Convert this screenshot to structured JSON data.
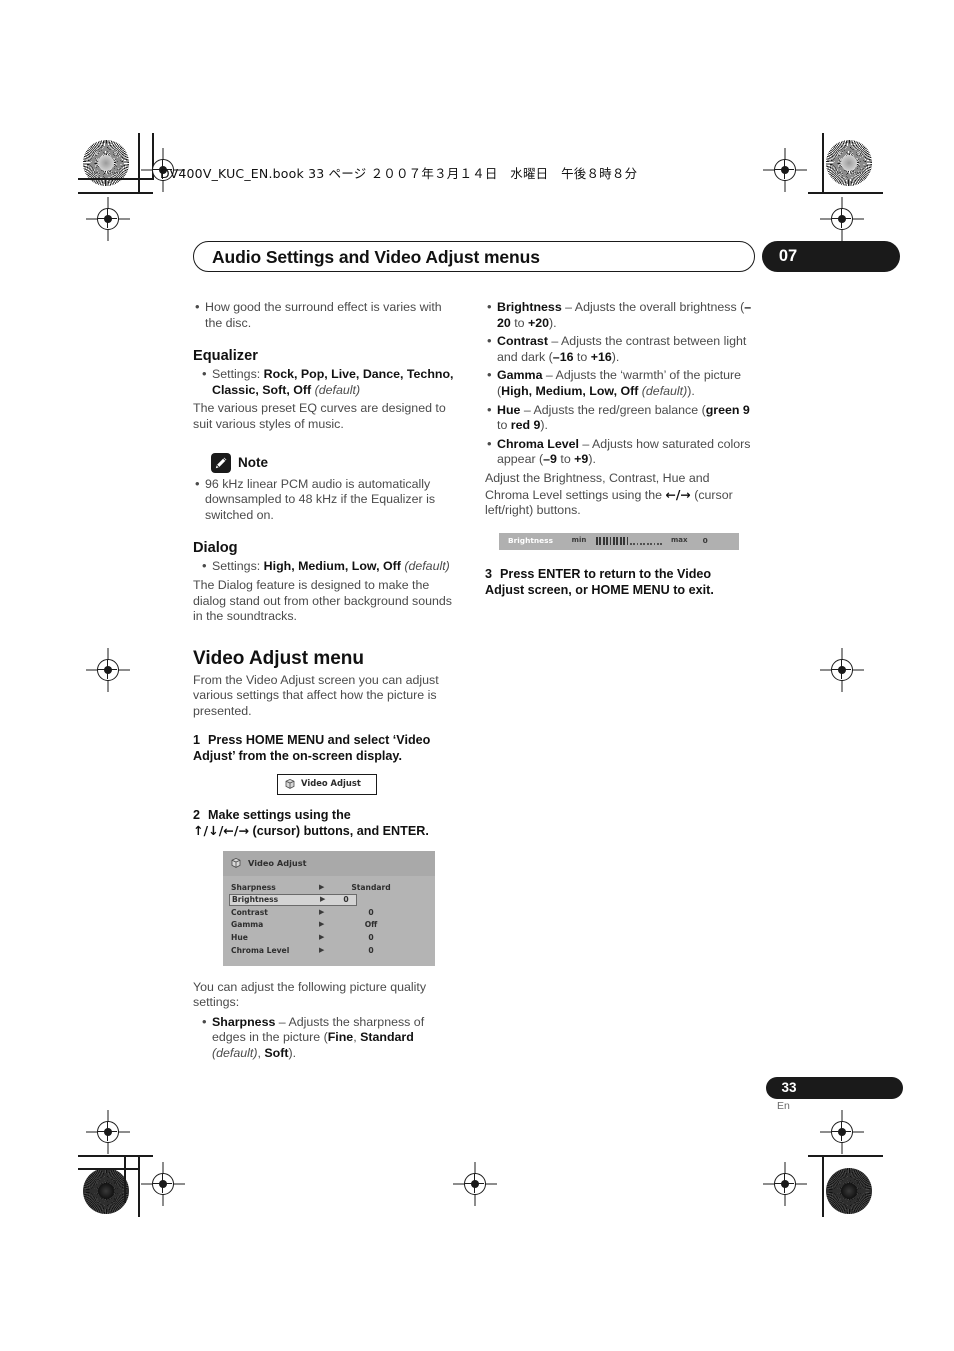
{
  "book_line": "DV400V_KUC_EN.book 33 ページ ２００７年３月１４日　水曜日　午後８時８分",
  "header": {
    "chapter_title": "Audio Settings and Video Adjust menus",
    "chapter_number": "07"
  },
  "left_column": {
    "intro_bullets": [
      "How good the surround effect is varies with the disc."
    ],
    "equalizer": {
      "heading": "Equalizer",
      "settings_prefix": "Settings:",
      "settings_values": "Rock, Pop, Live, Dance, Techno, Classic, Soft, Off",
      "settings_default": "(default)",
      "body": "The various preset EQ curves are designed to suit various styles of music."
    },
    "note": {
      "icon": "pencil-note-icon",
      "label": "Note",
      "bullet": "96 kHz linear PCM audio is automatically downsampled to 48 kHz if the Equalizer is switched on."
    },
    "dialog": {
      "heading": "Dialog",
      "settings_prefix": "Settings:",
      "settings_values": "High, Medium, Low, Off",
      "settings_default": "(default)",
      "body": "The Dialog feature is designed to make the dialog stand out from other background sounds in the soundtracks."
    },
    "video_adjust": {
      "heading": "Video Adjust menu",
      "intro": "From the Video Adjust screen you can adjust various settings that affect how the picture is presented.",
      "step1_number": "1",
      "step1_text": "Press HOME MENU and select ‘Video Adjust’ from the on-screen display.",
      "osd_button_label": "Video Adjust",
      "step2_number": "2",
      "step2_line1": "Make settings using the",
      "step2_arrows": "↑/↓/←/→",
      "step2_line2": "(cursor) buttons, and ENTER.",
      "after_menu_text": "You can adjust the following picture quality settings:",
      "sharpness_bullet": {
        "term": "Sharpness",
        "desc": " – Adjusts the sharpness of edges in the picture (",
        "opt1": "Fine",
        "sep1": ", ",
        "opt2": "Standard",
        "default_note": " (default)",
        "sep2": ", ",
        "opt3": "Soft",
        "tail": ")."
      }
    },
    "osd_menu": {
      "title": "Video Adjust",
      "arrow_glyph": "▶",
      "rows": [
        {
          "name": "Sharpness",
          "value": "Standard",
          "selected": false
        },
        {
          "name": "Brightness",
          "value": "0",
          "selected": true
        },
        {
          "name": "Contrast",
          "value": "0",
          "selected": false
        },
        {
          "name": "Gamma",
          "value": "Off",
          "selected": false
        },
        {
          "name": "Hue",
          "value": "0",
          "selected": false
        },
        {
          "name": "Chroma Level",
          "value": "0",
          "selected": false
        }
      ]
    }
  },
  "right_column": {
    "bullets": [
      {
        "term": "Brightness",
        "desc": " – Adjusts the overall brightness (",
        "range_low": "–20",
        "to": " to ",
        "range_high": "+20",
        "tail": ")."
      },
      {
        "term": "Contrast",
        "desc": " – Adjusts the contrast between light and dark (",
        "range_low": "–16",
        "to": " to ",
        "range_high": "+16",
        "tail": ")."
      },
      {
        "term": "Gamma",
        "desc": " – Adjusts the ‘warmth’ of the picture (",
        "opts": "High, Medium, Low, Off",
        "default_note": " (default)",
        "tail": ")."
      },
      {
        "term": "Hue",
        "desc": " – Adjusts the red/green balance (",
        "range_low": "green 9",
        "to": " to ",
        "range_high": "red 9",
        "tail": ")."
      },
      {
        "term": "Chroma Level",
        "desc": " – Adjusts how saturated colors appear (",
        "range_low": "–9",
        "to": " to ",
        "range_high": "+9",
        "tail": ")."
      }
    ],
    "adjust_note_1": "Adjust the Brightness, Contrast, Hue and Chroma Level settings using the ",
    "adjust_note_arrows": "←/→",
    "adjust_note_2": " (cursor left/right) buttons.",
    "slider": {
      "label": "Brightness",
      "min_label": "min",
      "max_label": "max",
      "value": "0",
      "filled_ticks": 10,
      "empty_ticks": 10
    },
    "step3_number": "3",
    "step3_text": "Press ENTER to return to the Video Adjust screen, or HOME MENU to exit."
  },
  "footer": {
    "page_number": "33",
    "language": "En"
  }
}
